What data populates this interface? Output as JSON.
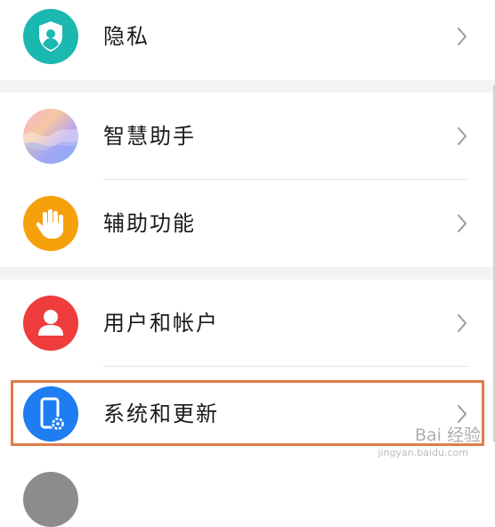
{
  "settings": {
    "items": [
      {
        "label": "隐私",
        "icon": "privacy-shield-icon",
        "color": "#1bb8b0"
      },
      {
        "label": "智慧助手",
        "icon": "smart-assistant-icon",
        "color": "#9b8cf0"
      },
      {
        "label": "辅助功能",
        "icon": "hand-icon",
        "color": "#f5a10c"
      },
      {
        "label": "用户和帐户",
        "icon": "user-icon",
        "color": "#ef3c3c"
      },
      {
        "label": "系统和更新",
        "icon": "phone-settings-icon",
        "color": "#1e7df0"
      }
    ]
  },
  "watermark": {
    "brand": "Bai 经验",
    "url": "jingyan.baidu.com"
  },
  "colors": {
    "highlight": "#e07b4c",
    "section_gap": "#f1f3f5"
  }
}
